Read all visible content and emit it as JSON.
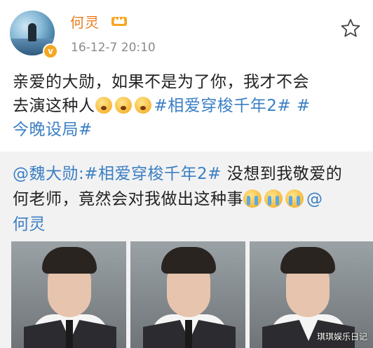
{
  "header": {
    "username": "何灵",
    "timestamp": "16-12-7 20:10",
    "verified_icon": "verified-v-icon",
    "crown_icon": "crown-icon",
    "favorite_icon": "star-icon"
  },
  "post": {
    "line1": "亲爱的大勋，如果不是为了你，我才不会",
    "line2_prefix": "去演这种人",
    "emoji_name": "fearful-face-emoji",
    "topic1": "#相爱穿梭千年2#",
    "topic2_part1": " #",
    "topic2_part2": "今晚设局#"
  },
  "repost": {
    "mention": "@魏大勋:",
    "topic": "#相爱穿梭千年2#",
    "text_part1": " 没想到我敬爱的",
    "text_part2": "何老师，竟然会对我做出这种事",
    "emoji_name": "crying-face-emoji",
    "mention2_part1": "@",
    "mention2_part2": "何灵"
  },
  "watermark": "琪琪娱乐日记",
  "colors": {
    "username": "#e77c1e",
    "link": "#3b7fc4",
    "repost_background": "#f2f2f2",
    "verified_badge": "#f6a623"
  }
}
